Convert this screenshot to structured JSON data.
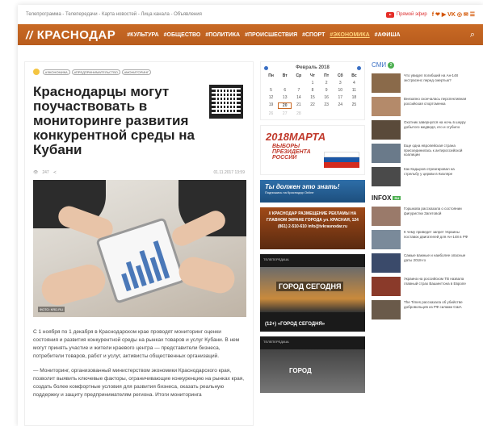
{
  "topbar": {
    "links": "Телепрограмма - Телепередачи - Карта новостей - Лица канала - Объявления",
    "live_label": "Прямой эфир",
    "social_icons": [
      "facebook-icon",
      "twitter-icon",
      "youtube-icon",
      "vk-icon",
      "instagram-icon",
      "ok-icon",
      "rss-icon"
    ],
    "social_glyphs": "f ❤ ▶ VK ◎ ✉ ☰"
  },
  "navbar": {
    "logo": "КРАСНОДАР",
    "logo_mark": "//",
    "links": [
      "#КУЛЬТУРА",
      "#ОБЩЕСТВО",
      "#ПОЛИТИКА",
      "#ПРОИСШЕСТВИЯ",
      "#СПОРТ",
      "#ЭКОНОМИКА",
      "#АФИША"
    ],
    "active_index": 5,
    "search_glyph": "⌕"
  },
  "article": {
    "tags": [
      "#ЭКОНОМИКА",
      "#ПРЕДПРИНИМАТЕЛЬСТВО",
      "#МОНИТОРИНГ"
    ],
    "title": "Краснодарцы могут поучаствовать в мониторинге развития конкурентной среды на Кубани",
    "views": "247",
    "date": "01.11.2017 13:59",
    "photo_caption": "ФОТО: KRD.RU",
    "paragraphs": [
      "С 1 ноября по 1 декабря в Краснодарском крае проводят мониторинг оценки состояния и развития конкурентной среды на рынках товаров и услуг Кубани. В нем могут принять участие и жители краевого центра — представители бизнеса, потребители товаров, работ и услуг, активисты общественных организаций.",
      "— Мониторинг, организованный министерством экономики Краснодарского края, позволит выявить ключевые факторы, ограничивающие конкуренцию на рынках края, создать более комфортные условия для развития бизнеса, оказать реальную поддержку и защиту предпринимателям региона. Итоги мониторинга"
    ]
  },
  "calendar": {
    "month": "Февраль 2018",
    "days": [
      "Пн",
      "Вт",
      "Ср",
      "Чт",
      "Пт",
      "Сб",
      "Вс"
    ],
    "weeks": [
      [
        "",
        "",
        "",
        "1",
        "2",
        "3",
        "4"
      ],
      [
        "5",
        "6",
        "7",
        "8",
        "9",
        "10",
        "11"
      ],
      [
        "12",
        "13",
        "14",
        "15",
        "16",
        "17",
        "18"
      ],
      [
        "19",
        "20",
        "21",
        "22",
        "23",
        "24",
        "25"
      ],
      [
        "26",
        "27",
        "28",
        "",
        "",
        "",
        ""
      ]
    ],
    "selected": "20"
  },
  "banners": {
    "election_year": "2018МАРТА",
    "election_text": "ВЫБОРЫ ПРЕЗИДЕНТА РОССИИ",
    "know_title": "Ты должен это знать!",
    "know_sub": "Подпишись на Краснодар Online",
    "ad_text": "// КРАСНОДАР РАЗМЕЩЕНИЕ РЕКЛАМЫ НА ГЛАВНОМ ЭКРАНЕ ГОРОДА ул. КРАСНАЯ, 124 (861) 2-510-610 info@tvkrasnodar.ru",
    "tv1_label": "ТЕЛЕПЕРЕДАЧА",
    "tv1_img_text": "ГОРОД СЕГОДНЯ",
    "tv1_caption": "(12+) «ГОРОД СЕГОДНЯ»",
    "tv2_label": "ТЕЛЕПЕРЕДАЧА",
    "tv2_img_text": "ГОРОД"
  },
  "smi": {
    "title": "СМИ",
    "count": "2",
    "items": [
      {
        "text": "Что увидел погибший на Ан-148 экстрасенс перед смертью?",
        "color": "#8a6a4a"
      },
      {
        "text": "Внезапно скончалась перспективная российская спортсменка",
        "color": "#b48a6a"
      },
      {
        "text": "Охотник завернулся на ночь в шкуру добытого медведя, его и сгубило",
        "color": "#5a4a3a"
      },
      {
        "text": "Еще одна европейская страна присоединилась к антироссийской коалиции",
        "color": "#6a7a8a"
      },
      {
        "text": "Как Кадыров отреагировал на стрельбу у церкви в Кизляре",
        "color": "#4a4a4a"
      }
    ]
  },
  "infox": {
    "title": "INFOX",
    "tag": "RU",
    "items": [
      {
        "text": "Горшкова рассказала о состоянии фигуристки Загитовой",
        "color": "#9a7a6a"
      },
      {
        "text": "К чему приведет запрет Украины поставок двигателей для Ан-148 в РФ",
        "color": "#7a8a9a"
      },
      {
        "text": "Самые важные и наиболее опасные даты 2018-го",
        "color": "#3a4a6a"
      },
      {
        "text": "Украина на российском ТВ назвала главный страх Вашингтона в Европе",
        "color": "#8a3a2a"
      },
      {
        "text": "The Times рассказала об убийстве добровольцев из РФ силами США",
        "color": "#6a5a4a"
      }
    ]
  }
}
